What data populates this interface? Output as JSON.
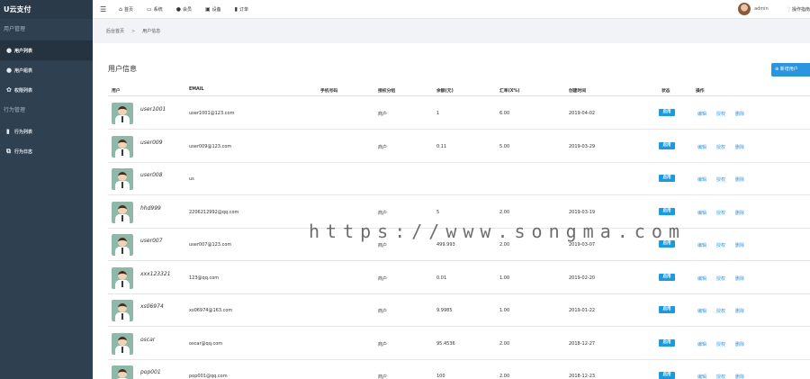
{
  "sidebar": {
    "logo": "U云支付",
    "sections": [
      {
        "title": "用户管理",
        "items": [
          {
            "label": "用户列表",
            "icon": "user-icon",
            "active": true
          },
          {
            "label": "用户组表",
            "icon": "users-icon",
            "active": false
          },
          {
            "label": "权限列表",
            "icon": "paw-icon",
            "active": false
          }
        ]
      },
      {
        "title": "行为管理",
        "items": [
          {
            "label": "行为列表",
            "icon": "file-icon",
            "active": false
          },
          {
            "label": "行为日志",
            "icon": "copy-icon",
            "active": false
          }
        ]
      }
    ]
  },
  "topbar": {
    "nav": [
      {
        "label": "首页",
        "icon": "home-icon"
      },
      {
        "label": "系统",
        "icon": "desktop-icon"
      },
      {
        "label": "会员",
        "icon": "user-icon"
      },
      {
        "label": "设备",
        "icon": "database-icon"
      },
      {
        "label": "订单",
        "icon": "file-icon"
      }
    ],
    "admin": "admin",
    "help": "操作指南"
  },
  "breadcrumb": {
    "home": "后台首页",
    "sep": ">",
    "current": "用户信息"
  },
  "page": {
    "title": "用户信息",
    "add_button": "新增用户"
  },
  "table": {
    "headers": [
      "用户",
      "EMAIL",
      "手机号码",
      "授权分组",
      "余额(元)",
      "汇率(X%)",
      "创建时间",
      "状态",
      "操作"
    ],
    "rows": [
      {
        "user": "user1001",
        "email": "user1001@123.com",
        "group": "商户",
        "balance": "1",
        "rate": "6.00",
        "date": "2019-04-02",
        "status": "启用"
      },
      {
        "user": "user009",
        "email": "user009@123.com",
        "group": "商户",
        "balance": "0.11",
        "rate": "5.00",
        "date": "2019-03-29",
        "status": "启用"
      },
      {
        "user": "user008",
        "email": "us",
        "group": "",
        "balance": "",
        "rate": "",
        "date": "",
        "status": "启用"
      },
      {
        "user": "hhd999",
        "email": "2206212992@qq.com",
        "group": "商户",
        "balance": "5",
        "rate": "2.00",
        "date": "2019-03-19",
        "status": "启用"
      },
      {
        "user": "user007",
        "email": "user007@123.com",
        "group": "商户",
        "balance": "499.993",
        "rate": "2.00",
        "date": "2019-03-07",
        "status": "启用"
      },
      {
        "user": "xxx123321",
        "email": "123@qq.com",
        "group": "商户",
        "balance": "0.01",
        "rate": "1.00",
        "date": "2019-02-20",
        "status": "启用"
      },
      {
        "user": "xs06974",
        "email": "xs06974@163.com",
        "group": "商户",
        "balance": "9.9985",
        "rate": "1.00",
        "date": "2019-01-22",
        "status": "启用"
      },
      {
        "user": "oscar",
        "email": "oscar@qq.com",
        "group": "商户",
        "balance": "95.4536",
        "rate": "2.00",
        "date": "2018-12-27",
        "status": "启用"
      },
      {
        "user": "pop001",
        "email": "pop001@qq.com",
        "group": "商户",
        "balance": "100",
        "rate": "2.00",
        "date": "2018-12-23",
        "status": "启用"
      }
    ],
    "actions": [
      "编辑",
      "授权",
      "删除"
    ]
  },
  "watermark": "https://www.songma.com",
  "colors": {
    "sidebar": "#2f4050",
    "accent": "#2a94de",
    "badge": "#1a9be0"
  }
}
